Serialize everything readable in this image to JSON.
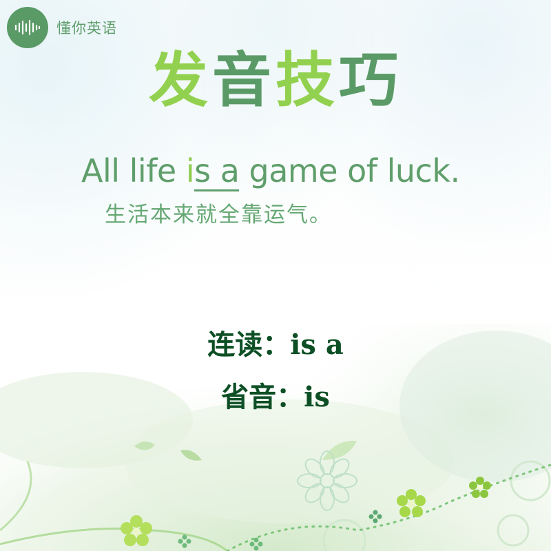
{
  "logo": {
    "icon": "sound-wave-icon",
    "text": "懂你英语"
  },
  "title": {
    "chars": [
      "发",
      "音",
      "技",
      "巧"
    ]
  },
  "sentence": {
    "before": "All life ",
    "highlight": "i",
    "underlined": "s a",
    "after": " game of luck."
  },
  "translation": "生活本来就全靠运气。",
  "notes": {
    "linking": "连读：is a",
    "elision": "省音：is"
  },
  "colors": {
    "logo_bg": "#5a9a66",
    "title_light": "#92d14f",
    "title_dark": "#5a9a66",
    "sentence": "#5f9e6b",
    "highlight": "#8fcb4f",
    "note": "#0d4f25"
  }
}
